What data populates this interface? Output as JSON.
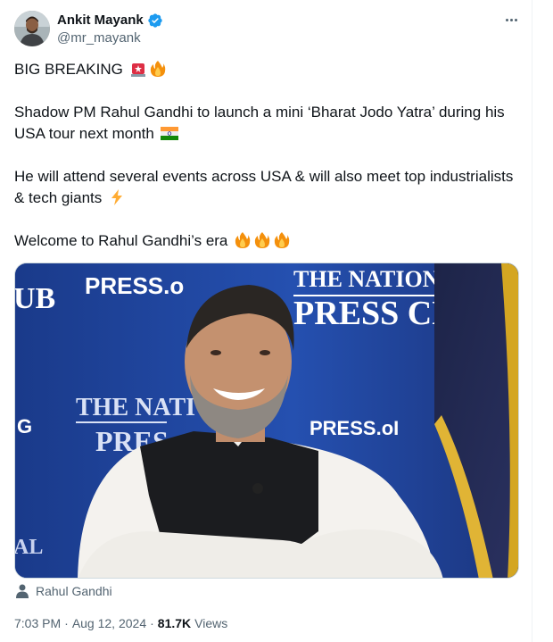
{
  "author": {
    "name": "Ankit Mayank",
    "handle": "@mr_mayank",
    "verified": true
  },
  "more_menu_icon": "more-horizontal-icon",
  "tweet": {
    "line1": "BIG BREAKING",
    "line2": "Shadow PM Rahul Gandhi to launch a mini ‘Bharat Jodo Yatra’ during his USA tour next month",
    "line3": "He will attend several events across USA & will also meet top industrialists & tech giants",
    "line4": "Welcome to Rahul Gandhi’s era"
  },
  "media": {
    "backdrop_text_1": "PRESS.o",
    "backdrop_text_2": "THE NATIONAL",
    "backdrop_text_3": "PRESS CLUB",
    "backdrop_text_4": "UB",
    "backdrop_text_5": "THE NATI",
    "backdrop_text_6": "PRES",
    "backdrop_text_7": "PRESS.oI",
    "backdrop_text_8": "G",
    "backdrop_text_9": "AL"
  },
  "tagged_person": "Rahul Gandhi",
  "timestamp": {
    "time": "7:03 PM",
    "separator": "·",
    "date": "Aug 12, 2024",
    "views_count": "81.7K",
    "views_label": "Views"
  },
  "colors": {
    "verified_blue": "#1d9bf0",
    "secondary_text": "#536471",
    "backdrop_blue": "#1c3c8c"
  },
  "icons": [
    "siren-emoji",
    "fire-emoji",
    "india-flag-emoji",
    "lightning-emoji",
    "person-icon",
    "verified-badge-icon"
  ]
}
